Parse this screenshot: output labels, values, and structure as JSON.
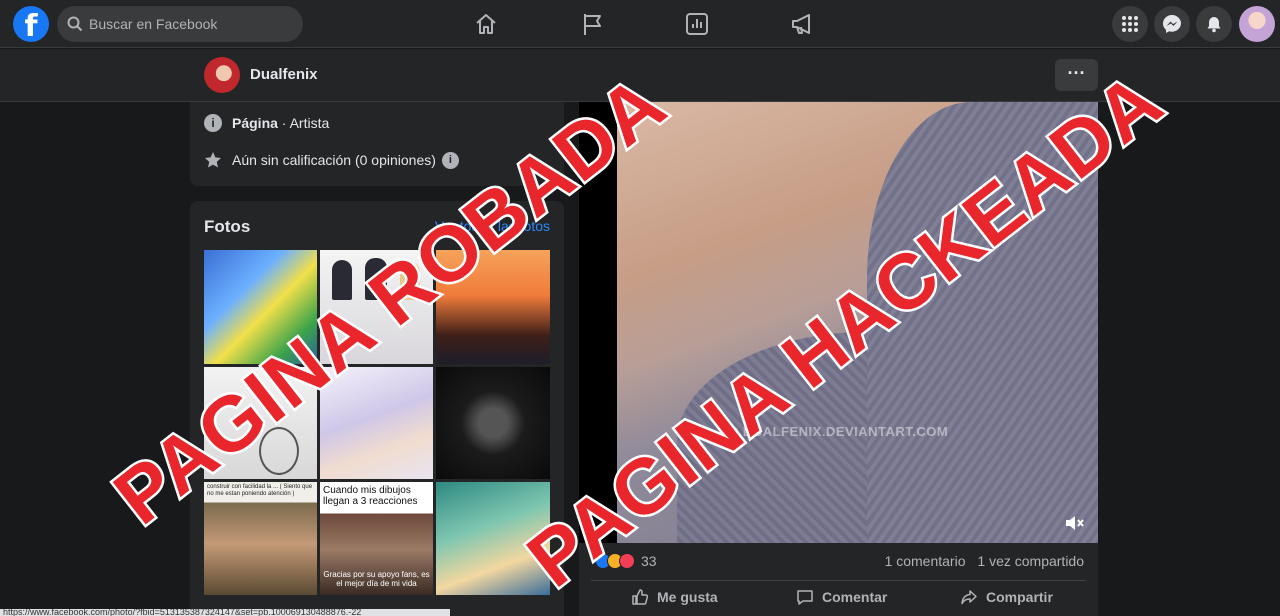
{
  "topbar": {
    "logo": "f",
    "search_placeholder": "Buscar en Facebook",
    "nav_icons": [
      "home-icon",
      "flag-icon",
      "chart-icon",
      "megaphone-icon"
    ],
    "right_icons": [
      "menu-grid-icon",
      "messenger-icon",
      "bell-icon",
      "user-avatar"
    ]
  },
  "page": {
    "name": "Dualfenix",
    "more_label": "···",
    "category_bold": "Página",
    "category_rest": " · Artista",
    "rating": "Aún sin calificación (0 opiniones)",
    "info_glyph": "i"
  },
  "photos": {
    "title": "Fotos",
    "see_all": "Ver todas las fotos",
    "tiles": [
      {
        "caption": "",
        "caption2": ""
      },
      {
        "caption": "",
        "caption2": ""
      },
      {
        "caption": "",
        "caption2": ""
      },
      {
        "caption": "",
        "caption2": ""
      },
      {
        "caption": "",
        "caption2": ""
      },
      {
        "caption": "",
        "caption2": ""
      },
      {
        "caption": "construir con facilidad la ... ( Siento que no me estan poniendo atención )",
        "caption2": ""
      },
      {
        "caption": "Cuando mis dibujos llegan a 3 reacciones",
        "caption2": "Gracias por su apoyo fans, es el mejor día de mi vida"
      },
      {
        "caption": "",
        "caption2": ""
      }
    ]
  },
  "post": {
    "watermark": "© DUALFENIX.DEVIANTART.COM",
    "mute_glyph": "🔇",
    "reaction_count": "33",
    "comments": "1 comentario",
    "shares": "1 vez compartido",
    "like_label": "Me gusta",
    "comment_label": "Comentar",
    "share_label": "Compartir"
  },
  "statusbar": {
    "url": "https://www.facebook.com/photo/?fbid=513135387324147&set=pb.100069130488876.-22"
  },
  "overlay": {
    "text1": "PAGINA ROBADA",
    "text2": "PAGINA HACKEADA"
  },
  "colors": {
    "fb_blue": "#1877f2",
    "overlay_red": "#e8262b",
    "link_blue": "#2d88ff"
  }
}
